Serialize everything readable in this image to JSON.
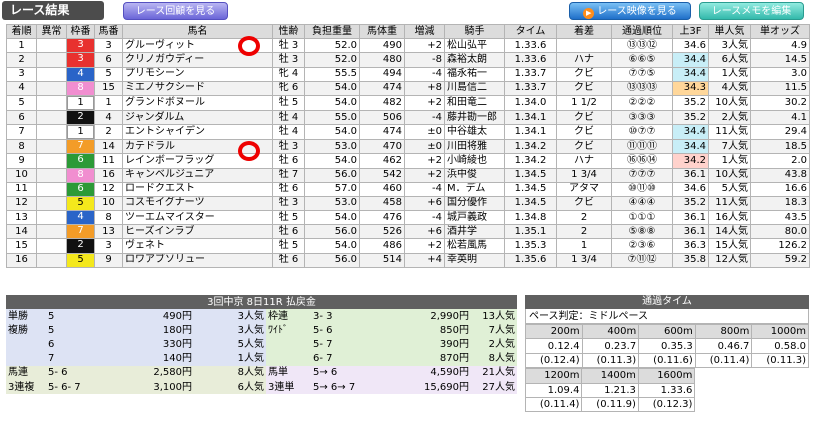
{
  "header": {
    "title": "レース結果",
    "replay_button": "レース回顧を見る",
    "video_button": "レース映像を見る",
    "memo_button": "レースメモを編集",
    "play_glyph": "▶"
  },
  "colors": {
    "frame_1": "#ffffff",
    "frame_2": "#111111",
    "frame_3": "#e8312f",
    "frame_4": "#2a64c8",
    "frame_5": "#f4e81c",
    "frame_6": "#2c9a37",
    "frame_7": "#f39c28",
    "frame_8": "#f18ed0",
    "last3f_hi": "#c8eef7",
    "last3f_best": "#ffd79a",
    "last3f_second": "#ffd2cc"
  },
  "columns": [
    "着順",
    "異常",
    "枠番",
    "馬番",
    "馬名",
    "性齢",
    "負担重量",
    "馬体重",
    "増減",
    "騎手",
    "タイム",
    "着差",
    "通過順位",
    "上3F",
    "単人気",
    "単オッズ"
  ],
  "results": [
    {
      "pos": "1",
      "ab": "",
      "frame": "3",
      "num": "3",
      "name": "グルーヴィット",
      "sexage": "牡 3",
      "wt": "52.0",
      "body": "490",
      "diff": "+2",
      "jockey": "松山弘平",
      "time": "1.33.6",
      "margin": "",
      "pass": "⑬⑬⑫",
      "f3": "34.6",
      "f3c": "",
      "pop": "3人気",
      "odds": "4.9"
    },
    {
      "pos": "2",
      "ab": "",
      "frame": "3",
      "num": "6",
      "name": "クリノガウディー",
      "sexage": "牡 3",
      "wt": "52.0",
      "body": "480",
      "diff": "-8",
      "jockey": "森裕太朗",
      "time": "1.33.6",
      "margin": "ハナ",
      "pass": "⑥⑥⑤",
      "f3": "34.4",
      "f3c": "hi",
      "pop": "6人気",
      "odds": "14.5"
    },
    {
      "pos": "3",
      "ab": "",
      "frame": "4",
      "num": "5",
      "name": "プリモシーン",
      "sexage": "牝 4",
      "wt": "55.5",
      "body": "494",
      "diff": "-4",
      "jockey": "福永祐一",
      "time": "1.33.7",
      "margin": "クビ",
      "pass": "⑦⑦⑤",
      "f3": "34.4",
      "f3c": "hi",
      "pop": "1人気",
      "odds": "3.0"
    },
    {
      "pos": "4",
      "ab": "",
      "frame": "8",
      "num": "15",
      "name": "ミエノサクシード",
      "sexage": "牝 6",
      "wt": "54.0",
      "body": "474",
      "diff": "+8",
      "jockey": "川島信二",
      "time": "1.33.7",
      "margin": "クビ",
      "pass": "⑬⑬⑬",
      "f3": "34.3",
      "f3c": "best",
      "pop": "4人気",
      "odds": "11.5"
    },
    {
      "pos": "5",
      "ab": "",
      "frame": "1",
      "num": "1",
      "name": "グランドボヌール",
      "sexage": "牡 5",
      "wt": "54.0",
      "body": "482",
      "diff": "+2",
      "jockey": "和田竜二",
      "time": "1.34.0",
      "margin": "1 1/2",
      "pass": "②②②",
      "f3": "35.2",
      "f3c": "",
      "pop": "10人気",
      "odds": "30.2"
    },
    {
      "pos": "6",
      "ab": "",
      "frame": "2",
      "num": "4",
      "name": "ジャンダルム",
      "sexage": "牡 4",
      "wt": "55.0",
      "body": "506",
      "diff": "-4",
      "jockey": "藤井勘一郎",
      "time": "1.34.1",
      "margin": "クビ",
      "pass": "③③③",
      "f3": "35.2",
      "f3c": "",
      "pop": "2人気",
      "odds": "4.1"
    },
    {
      "pos": "7",
      "ab": "",
      "frame": "1",
      "num": "2",
      "name": "エントシャイデン",
      "sexage": "牡 4",
      "wt": "54.0",
      "body": "474",
      "diff": "±0",
      "jockey": "中谷雄太",
      "time": "1.34.1",
      "margin": "クビ",
      "pass": "⑩⑦⑦",
      "f3": "34.4",
      "f3c": "hi",
      "pop": "11人気",
      "odds": "29.4"
    },
    {
      "pos": "8",
      "ab": "",
      "frame": "7",
      "num": "14",
      "name": "カテドラル",
      "sexage": "牡 3",
      "wt": "53.0",
      "body": "470",
      "diff": "±0",
      "jockey": "川田将雅",
      "time": "1.34.2",
      "margin": "クビ",
      "pass": "⑪⑪⑪",
      "f3": "34.4",
      "f3c": "hi",
      "pop": "7人気",
      "odds": "18.5"
    },
    {
      "pos": "9",
      "ab": "",
      "frame": "6",
      "num": "11",
      "name": "レインボーフラッグ",
      "sexage": "牡 6",
      "wt": "54.0",
      "body": "462",
      "diff": "+2",
      "jockey": "小崎綾也",
      "time": "1.34.2",
      "margin": "ハナ",
      "pass": "⑯⑯⑭",
      "f3": "34.2",
      "f3c": "second",
      "pop": "1人気",
      "odds": "2.0"
    },
    {
      "pos": "10",
      "ab": "",
      "frame": "8",
      "num": "16",
      "name": "キャンベルジュニア",
      "sexage": "牡 7",
      "wt": "56.0",
      "body": "542",
      "diff": "+2",
      "jockey": "浜中俊",
      "time": "1.34.5",
      "margin": "1 3/4",
      "pass": "⑦⑦⑦",
      "f3": "36.1",
      "f3c": "",
      "pop": "10人気",
      "odds": "43.8"
    },
    {
      "pos": "11",
      "ab": "",
      "frame": "6",
      "num": "12",
      "name": "ロードクエスト",
      "sexage": "牡 6",
      "wt": "57.0",
      "body": "460",
      "diff": "-4",
      "jockey": "M．デム",
      "time": "1.34.5",
      "margin": "アタマ",
      "pass": "⑩⑪⑩",
      "f3": "34.6",
      "f3c": "",
      "pop": "5人気",
      "odds": "16.6"
    },
    {
      "pos": "12",
      "ab": "",
      "frame": "5",
      "num": "10",
      "name": "コスモイグナーツ",
      "sexage": "牡 3",
      "wt": "53.0",
      "body": "458",
      "diff": "+6",
      "jockey": "国分優作",
      "time": "1.34.5",
      "margin": "クビ",
      "pass": "④④④",
      "f3": "35.2",
      "f3c": "",
      "pop": "11人気",
      "odds": "18.3"
    },
    {
      "pos": "13",
      "ab": "",
      "frame": "4",
      "num": "8",
      "name": "ツーエムマイスター",
      "sexage": "牡 5",
      "wt": "54.0",
      "body": "476",
      "diff": "-4",
      "jockey": "城戸義政",
      "time": "1.34.8",
      "margin": "2",
      "pass": "①①①",
      "f3": "36.1",
      "f3c": "",
      "pop": "16人気",
      "odds": "43.5"
    },
    {
      "pos": "14",
      "ab": "",
      "frame": "7",
      "num": "13",
      "name": "ヒーズインラブ",
      "sexage": "牡 6",
      "wt": "56.0",
      "body": "526",
      "diff": "+6",
      "jockey": "酒井学",
      "time": "1.35.1",
      "margin": "2",
      "pass": "⑤⑧⑧",
      "f3": "36.1",
      "f3c": "",
      "pop": "14人気",
      "odds": "80.0"
    },
    {
      "pos": "15",
      "ab": "",
      "frame": "2",
      "num": "3",
      "name": "ヴェネト",
      "sexage": "牡 5",
      "wt": "54.0",
      "body": "486",
      "diff": "+2",
      "jockey": "松若風馬",
      "time": "1.35.3",
      "margin": "1",
      "pass": "②③⑥",
      "f3": "36.3",
      "f3c": "",
      "pop": "15人気",
      "odds": "126.2"
    },
    {
      "pos": "16",
      "ab": "",
      "frame": "5",
      "num": "9",
      "name": "ロワアブソリュー",
      "sexage": "牡 6",
      "wt": "56.0",
      "body": "514",
      "diff": "+4",
      "jockey": "幸英明",
      "time": "1.35.6",
      "margin": "1 3/4",
      "pass": "⑦⑪⑫",
      "f3": "35.8",
      "f3c": "",
      "pop": "12人気",
      "odds": "59.2"
    }
  ],
  "payout": {
    "title": "3回中京 8日11R 払戻金",
    "rows": [
      {
        "t1": "単勝",
        "c1": "5",
        "y1": "490円",
        "p1": "3人気",
        "t2": "枠連",
        "c2": "3- 3",
        "y2": "2,990円",
        "p2": "13人気"
      },
      {
        "t1": "複勝",
        "c1": "5",
        "y1": "180円",
        "p1": "3人気",
        "t2": "ﾜｲﾄﾞ",
        "c2": "5- 6",
        "y2": "850円",
        "p2": "7人気"
      },
      {
        "t1": "",
        "c1": "6",
        "y1": "330円",
        "p1": "5人気",
        "t2": "",
        "c2": "5- 7",
        "y2": "390円",
        "p2": "2人気"
      },
      {
        "t1": "",
        "c1": "7",
        "y1": "140円",
        "p1": "1人気",
        "t2": "",
        "c2": "6- 7",
        "y2": "870円",
        "p2": "8人気"
      },
      {
        "t1": "馬連",
        "c1": "5- 6",
        "y1": "2,580円",
        "p1": "8人気",
        "t2": "馬単",
        "c2": "5→ 6",
        "y2": "4,590円",
        "p2": "21人気"
      },
      {
        "t1": "3連複",
        "c1": "5- 6- 7",
        "y1": "3,100円",
        "p1": "6人気",
        "t2": "3連単",
        "c2": "5→ 6→ 7",
        "y2": "15,690円",
        "p2": "27人気"
      }
    ]
  },
  "passing": {
    "title": "通過タイム",
    "pace": "ペース判定：ミドルペース",
    "row1": [
      {
        "d": "200m",
        "t": "0.12.4",
        "c": "(0.12.4)"
      },
      {
        "d": "400m",
        "t": "0.23.7",
        "c": "(0.11.3)"
      },
      {
        "d": "600m",
        "t": "0.35.3",
        "c": "(0.11.6)"
      },
      {
        "d": "800m",
        "t": "0.46.7",
        "c": "(0.11.4)"
      },
      {
        "d": "1000m",
        "t": "0.58.0",
        "c": "(0.11.3)"
      }
    ],
    "row2": [
      {
        "d": "1200m",
        "t": "1.09.4",
        "c": "(0.11.4)"
      },
      {
        "d": "1400m",
        "t": "1.21.3",
        "c": "(0.11.9)"
      },
      {
        "d": "1600m",
        "t": "1.33.6",
        "c": "(0.12.3)"
      }
    ]
  }
}
